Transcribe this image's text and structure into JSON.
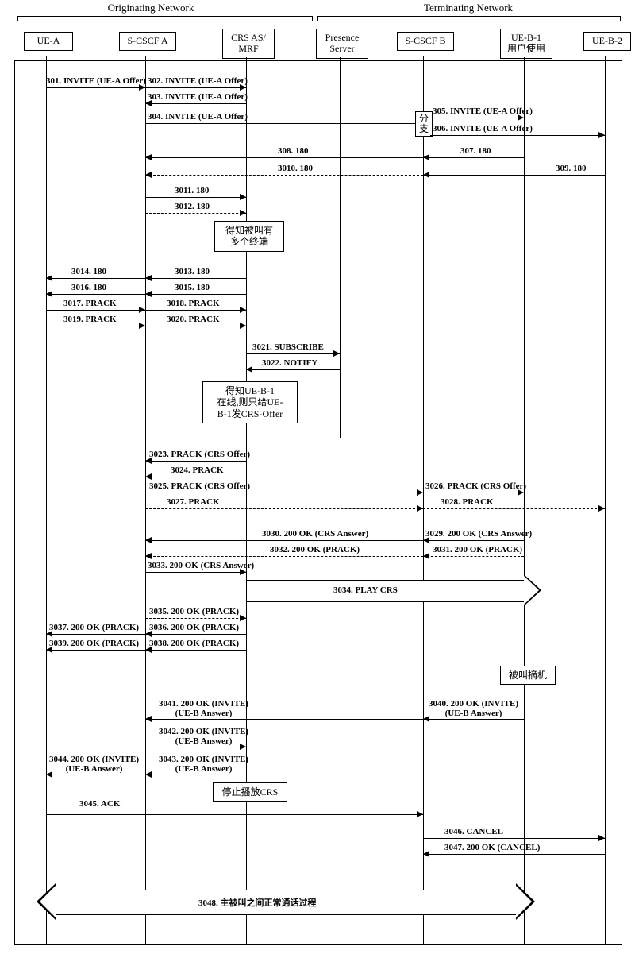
{
  "labels": {
    "originating": "Originating Network",
    "terminating": "Terminating Network"
  },
  "actors": {
    "uea": "UE-A",
    "scscfa": "S-CSCF A",
    "crs": "CRS AS/\nMRF",
    "presence": "Presence\nServer",
    "scscfb": "S-CSCF B",
    "ueb1": "UE-B-1\n用户使用",
    "ueb2": "UE-B-2"
  },
  "fork": "分\n支",
  "notes": {
    "multi": "得知被叫有\n多个终端",
    "online": "得知UE-B-1\n在线,则只给UE-\nB-1发CRS-Offer",
    "stop": "停止播放CRS",
    "offhook": "被叫摘机"
  },
  "msgs": {
    "m301": "301. INVITE (UE-A Offer)",
    "m302": "302. INVITE (UE-A Offer)",
    "m303": "303. INVITE (UE-A Offer)",
    "m304": "304. INVITE (UE-A Offer)",
    "m305": "305. INVITE (UE-A Offer)",
    "m306": "306. INVITE (UE-A Offer)",
    "m307": "307. 180",
    "m308": "308. 180",
    "m309": "309. 180",
    "m3010": "3010. 180",
    "m3011": "3011. 180",
    "m3012": "3012. 180",
    "m3013": "3013. 180",
    "m3014": "3014. 180",
    "m3015": "3015. 180",
    "m3016": "3016. 180",
    "m3017": "3017. PRACK",
    "m3018": "3018. PRACK",
    "m3019": "3019. PRACK",
    "m3020": "3020. PRACK",
    "m3021": "3021. SUBSCRIBE",
    "m3022": "3022. NOTIFY",
    "m3023": "3023. PRACK (CRS Offer)",
    "m3024": "3024. PRACK",
    "m3025": "3025. PRACK (CRS Offer)",
    "m3026": "3026. PRACK (CRS Offer)",
    "m3027": "3027. PRACK",
    "m3028": "3028. PRACK",
    "m3029": "3029. 200 OK (CRS Answer)",
    "m3030": "3030. 200 OK (CRS Answer)",
    "m3031": "3031. 200 OK (PRACK)",
    "m3032": "3032. 200 OK (PRACK)",
    "m3033": "3033. 200 OK (CRS Answer)",
    "m3034": "3034. PLAY CRS",
    "m3035": "3035. 200 OK (PRACK)",
    "m3036": "3036. 200 OK (PRACK)",
    "m3037": "3037. 200 OK (PRACK)",
    "m3038": "3038. 200 OK (PRACK)",
    "m3039": "3039. 200 OK (PRACK)",
    "m3040": "3040. 200 OK (INVITE)\n(UE-B Answer)",
    "m3041": "3041. 200 OK (INVITE)\n(UE-B Answer)",
    "m3042": "3042. 200 OK (INVITE)\n(UE-B Answer)",
    "m3043": "3043. 200 OK (INVITE)\n(UE-B Answer)",
    "m3044": "3044. 200 OK (INVITE)\n(UE-B Answer)",
    "m3045": "3045. ACK",
    "m3046": "3046. CANCEL",
    "m3047": "3047. 200 OK (CANCEL)",
    "m3048": "3048. 主被叫之间正常通话过程"
  }
}
